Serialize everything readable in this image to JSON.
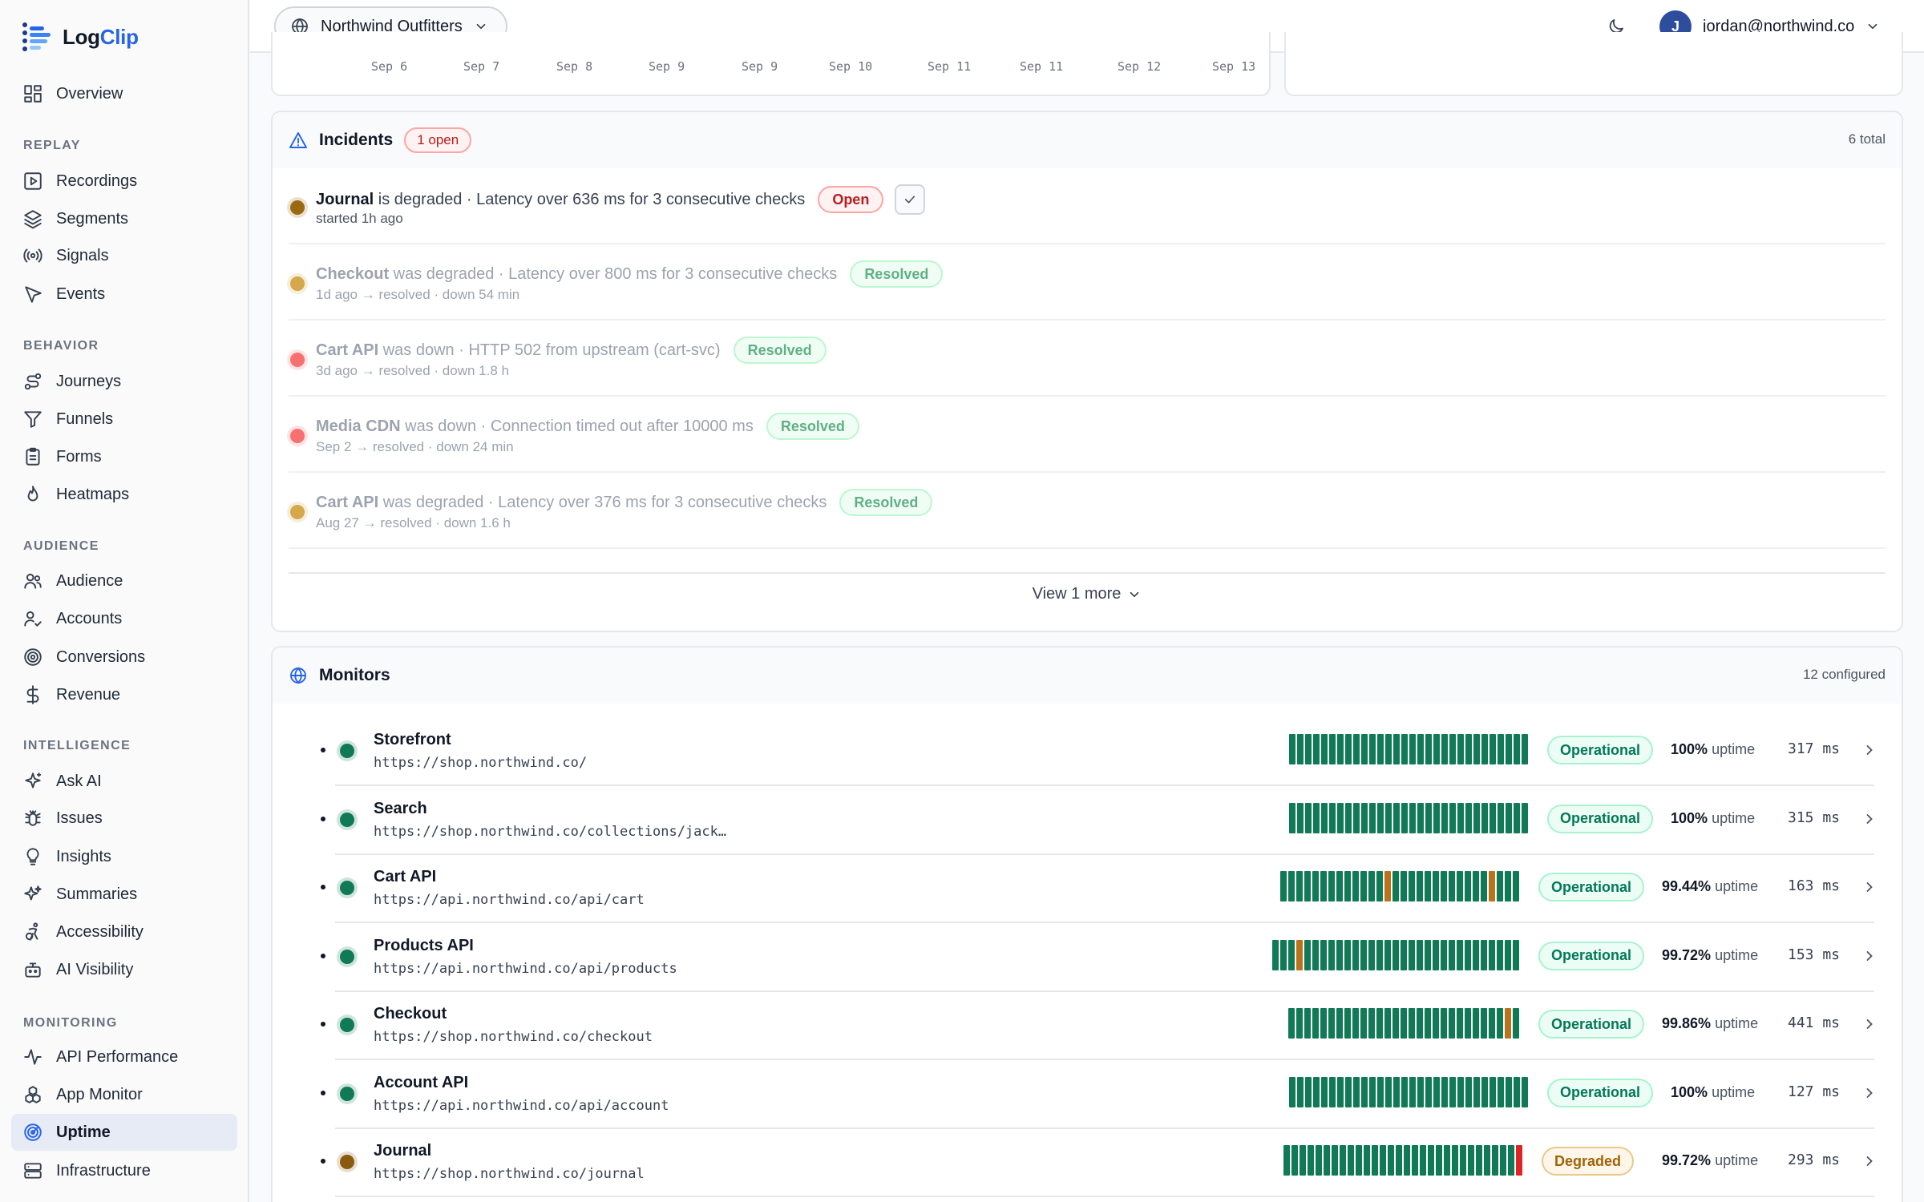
{
  "app": {
    "name_part1": "Log",
    "name_part2": "Clip"
  },
  "nav": {
    "overview": "Overview",
    "sections": {
      "replay": "REPLAY",
      "behavior": "BEHAVIOR",
      "audience": "AUDIENCE",
      "intelligence": "INTELLIGENCE",
      "monitoring": "MONITORING"
    },
    "items": [
      {
        "id": "recordings",
        "label": "Recordings",
        "icon": "play-square-icon"
      },
      {
        "id": "segments",
        "label": "Segments",
        "icon": "layers-icon"
      },
      {
        "id": "signals",
        "label": "Signals",
        "icon": "radio-icon"
      },
      {
        "id": "events",
        "label": "Events",
        "icon": "cursor-icon"
      },
      {
        "id": "journeys",
        "label": "Journeys",
        "icon": "route-icon"
      },
      {
        "id": "funnels",
        "label": "Funnels",
        "icon": "funnel-icon"
      },
      {
        "id": "forms",
        "label": "Forms",
        "icon": "clipboard-icon"
      },
      {
        "id": "heatmaps",
        "label": "Heatmaps",
        "icon": "flame-icon"
      },
      {
        "id": "audience",
        "label": "Audience",
        "icon": "users-icon"
      },
      {
        "id": "accounts",
        "label": "Accounts",
        "icon": "user-check-icon"
      },
      {
        "id": "conversions",
        "label": "Conversions",
        "icon": "target-icon"
      },
      {
        "id": "revenue",
        "label": "Revenue",
        "icon": "dollar-icon"
      },
      {
        "id": "ask-ai",
        "label": "Ask AI",
        "icon": "sparkle-icon"
      },
      {
        "id": "issues",
        "label": "Issues",
        "icon": "bug-icon"
      },
      {
        "id": "insights",
        "label": "Insights",
        "icon": "lightbulb-icon"
      },
      {
        "id": "summaries",
        "label": "Summaries",
        "icon": "sparkles-icon"
      },
      {
        "id": "accessibility",
        "label": "Accessibility",
        "icon": "accessibility-icon"
      },
      {
        "id": "ai-visibility",
        "label": "AI Visibility",
        "icon": "bot-icon"
      },
      {
        "id": "api-performance",
        "label": "API Performance",
        "icon": "activity-icon"
      },
      {
        "id": "app-monitor",
        "label": "App Monitor",
        "icon": "boxes-icon"
      },
      {
        "id": "uptime",
        "label": "Uptime",
        "icon": "radar-icon",
        "active": true
      },
      {
        "id": "infrastructure",
        "label": "Infrastructure",
        "icon": "server-icon"
      }
    ]
  },
  "header": {
    "workspace": "Northwind Outfitters",
    "user_initial": "J",
    "user_email": "jordan@northwind.co"
  },
  "chart": {
    "x_ticks": [
      "Sep 6",
      "Sep 7",
      "Sep 8",
      "Sep 9",
      "Sep 9",
      "Sep 10",
      "Sep 11",
      "Sep 11",
      "Sep 12",
      "Sep 13"
    ]
  },
  "incidents": {
    "title": "Incidents",
    "open_badge": "1 open",
    "total": "6 total",
    "rows": [
      {
        "name": "Journal",
        "verb": " is degraded",
        "detail": " · Latency over 636 ms for 3 consecutive checks",
        "meta": "started 1h ago",
        "status": "Open",
        "kind": "degraded",
        "open": true
      },
      {
        "name": "Checkout",
        "verb": " was degraded",
        "detail": " · Latency over 800 ms for 3 consecutive checks",
        "meta": "1d ago → resolved · down 54 min",
        "status": "Resolved",
        "kind": "degraded",
        "open": false
      },
      {
        "name": "Cart API",
        "verb": " was down",
        "detail": " · HTTP 502 from upstream (cart-svc)",
        "meta": "3d ago → resolved · down 1.8 h",
        "status": "Resolved",
        "kind": "down",
        "open": false
      },
      {
        "name": "Media CDN",
        "verb": " was down",
        "detail": " · Connection timed out after 10000 ms",
        "meta": "Sep 2 → resolved · down 24 min",
        "status": "Resolved",
        "kind": "down",
        "open": false
      },
      {
        "name": "Cart API",
        "verb": " was degraded",
        "detail": " · Latency over 376 ms for 3 consecutive checks",
        "meta": "Aug 27 → resolved · down 1.6 h",
        "status": "Resolved",
        "kind": "degraded",
        "open": false
      }
    ],
    "view_more": "View 1 more"
  },
  "monitors": {
    "title": "Monitors",
    "count": "12 configured",
    "uptime_word": "uptime",
    "rows": [
      {
        "name": "Storefront",
        "url": "https://shop.northwind.co/",
        "status": "Operational",
        "uptime": "100%",
        "latency": "317 ms",
        "bars": "gggggggggggggggggggggggggggggg"
      },
      {
        "name": "Search",
        "url": "https://shop.northwind.co/collections/jack…",
        "status": "Operational",
        "uptime": "100%",
        "latency": "315 ms",
        "bars": "gggggggggggggggggggggggggggggg"
      },
      {
        "name": "Cart API",
        "url": "https://api.northwind.co/api/cart",
        "status": "Operational",
        "uptime": "99.44%",
        "latency": "163 ms",
        "bars": "gggggggggggggoggggggggggggoggg"
      },
      {
        "name": "Products API",
        "url": "https://api.northwind.co/api/products",
        "status": "Operational",
        "uptime": "99.72%",
        "latency": "153 ms",
        "bars": "gggoggggggggggggggggggggggggggg"
      },
      {
        "name": "Checkout",
        "url": "https://shop.northwind.co/checkout",
        "status": "Operational",
        "uptime": "99.86%",
        "latency": "441 ms",
        "bars": "gggggggggggggggggggggggggggog"
      },
      {
        "name": "Account API",
        "url": "https://api.northwind.co/api/account",
        "status": "Operational",
        "uptime": "100%",
        "latency": "127 ms",
        "bars": "gggggggggggggggggggggggggggggg"
      },
      {
        "name": "Journal",
        "url": "https://shop.northwind.co/journal",
        "status": "Degraded",
        "uptime": "99.72%",
        "latency": "293 ms",
        "bars": "gggggggggggggggggggggggggggggr"
      }
    ]
  },
  "colors": {
    "accent": "#2563eb",
    "operational": "#047857",
    "degraded": "#a16207",
    "down_dot": "#f87171",
    "degraded_dot": "#d4a84b",
    "bar_green": "#0f7a55",
    "bar_orange": "#b8731c",
    "bar_red": "#dc2626"
  }
}
